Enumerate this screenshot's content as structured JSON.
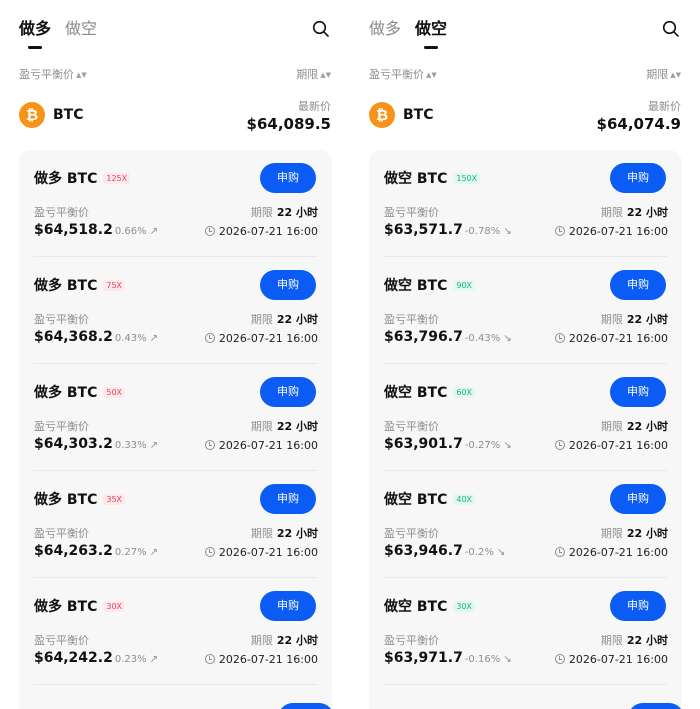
{
  "tabs": {
    "long": "做多",
    "short": "做空"
  },
  "sort": {
    "breakeven": "盈亏平衡价",
    "term": "期限",
    "arrows": "▲▼"
  },
  "asset": {
    "name": "BTC",
    "symbol": "₿"
  },
  "labels": {
    "latest_price": "最新价",
    "breakeven": "盈亏平衡价",
    "term": "期限",
    "buy": "申购"
  },
  "left": {
    "active_tab": "做多",
    "latest_price": "$64,089.5",
    "items": [
      {
        "title": "做多 BTC",
        "leverage": "125X",
        "breakeven": "$64,518.2",
        "change": "0.66% ↗",
        "term": "22 小时",
        "expiry": "2026-07-21 16:00"
      },
      {
        "title": "做多 BTC",
        "leverage": "75X",
        "breakeven": "$64,368.2",
        "change": "0.43% ↗",
        "term": "22 小时",
        "expiry": "2026-07-21 16:00"
      },
      {
        "title": "做多 BTC",
        "leverage": "50X",
        "breakeven": "$64,303.2",
        "change": "0.33% ↗",
        "term": "22 小时",
        "expiry": "2026-07-21 16:00"
      },
      {
        "title": "做多 BTC",
        "leverage": "35X",
        "breakeven": "$64,263.2",
        "change": "0.27% ↗",
        "term": "22 小时",
        "expiry": "2026-07-21 16:00"
      },
      {
        "title": "做多 BTC",
        "leverage": "30X",
        "breakeven": "$64,242.2",
        "change": "0.23% ↗",
        "term": "22 小时",
        "expiry": "2026-07-21 16:00"
      }
    ]
  },
  "right": {
    "active_tab": "做空",
    "latest_price": "$64,074.9",
    "items": [
      {
        "title": "做空 BTC",
        "leverage": "150X",
        "breakeven": "$63,571.7",
        "change": "-0.78% ↘",
        "term": "22 小时",
        "expiry": "2026-07-21 16:00"
      },
      {
        "title": "做空 BTC",
        "leverage": "90X",
        "breakeven": "$63,796.7",
        "change": "-0.43% ↘",
        "term": "22 小时",
        "expiry": "2026-07-21 16:00"
      },
      {
        "title": "做空 BTC",
        "leverage": "60X",
        "breakeven": "$63,901.7",
        "change": "-0.27% ↘",
        "term": "22 小时",
        "expiry": "2026-07-21 16:00"
      },
      {
        "title": "做空 BTC",
        "leverage": "40X",
        "breakeven": "$63,946.7",
        "change": "-0.2% ↘",
        "term": "22 小时",
        "expiry": "2026-07-21 16:00"
      },
      {
        "title": "做空 BTC",
        "leverage": "30X",
        "breakeven": "$63,971.7",
        "change": "-0.16% ↘",
        "term": "22 小时",
        "expiry": "2026-07-21 16:00"
      }
    ]
  }
}
